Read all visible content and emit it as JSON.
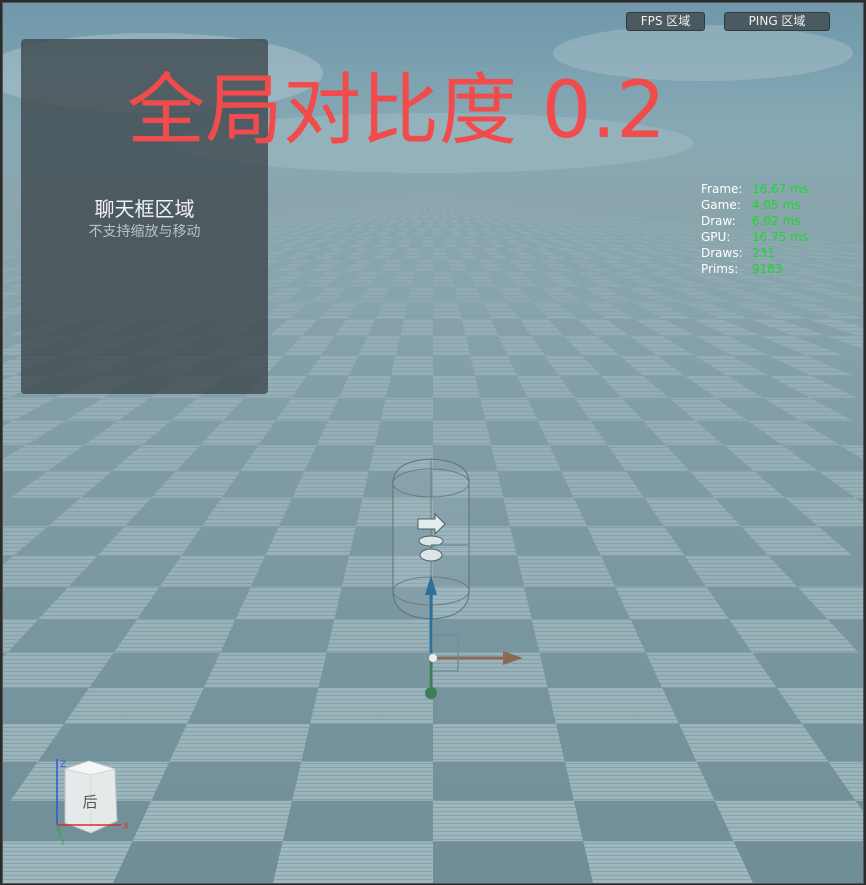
{
  "top_buttons": {
    "fps": "FPS 区域",
    "ping": "PING 区域"
  },
  "overlay": {
    "contrast_text": "全局对比度 0.2",
    "contrast_color": "#f24b4b"
  },
  "chat_panel": {
    "title": "聊天框区域",
    "subtitle": "不支持缩放与移动"
  },
  "stats": [
    {
      "label": "Frame:",
      "value": "16.67 ms"
    },
    {
      "label": "Game:",
      "value": "4.05 ms"
    },
    {
      "label": "Draw:",
      "value": "6.02 ms"
    },
    {
      "label": "GPU:",
      "value": "16.75 ms"
    },
    {
      "label": "Draws:",
      "value": "231"
    },
    {
      "label": "Prims:",
      "value": "9183"
    }
  ],
  "view_cube": {
    "face_label": "后",
    "axis_z": "Z",
    "axis_x": "X",
    "axis_y": "Y"
  },
  "colors": {
    "stat_value": "#19d92a",
    "gizmo_up": "#2f6f9c",
    "gizmo_forward": "#8a6a55",
    "gizmo_down": "#3d7d55"
  }
}
